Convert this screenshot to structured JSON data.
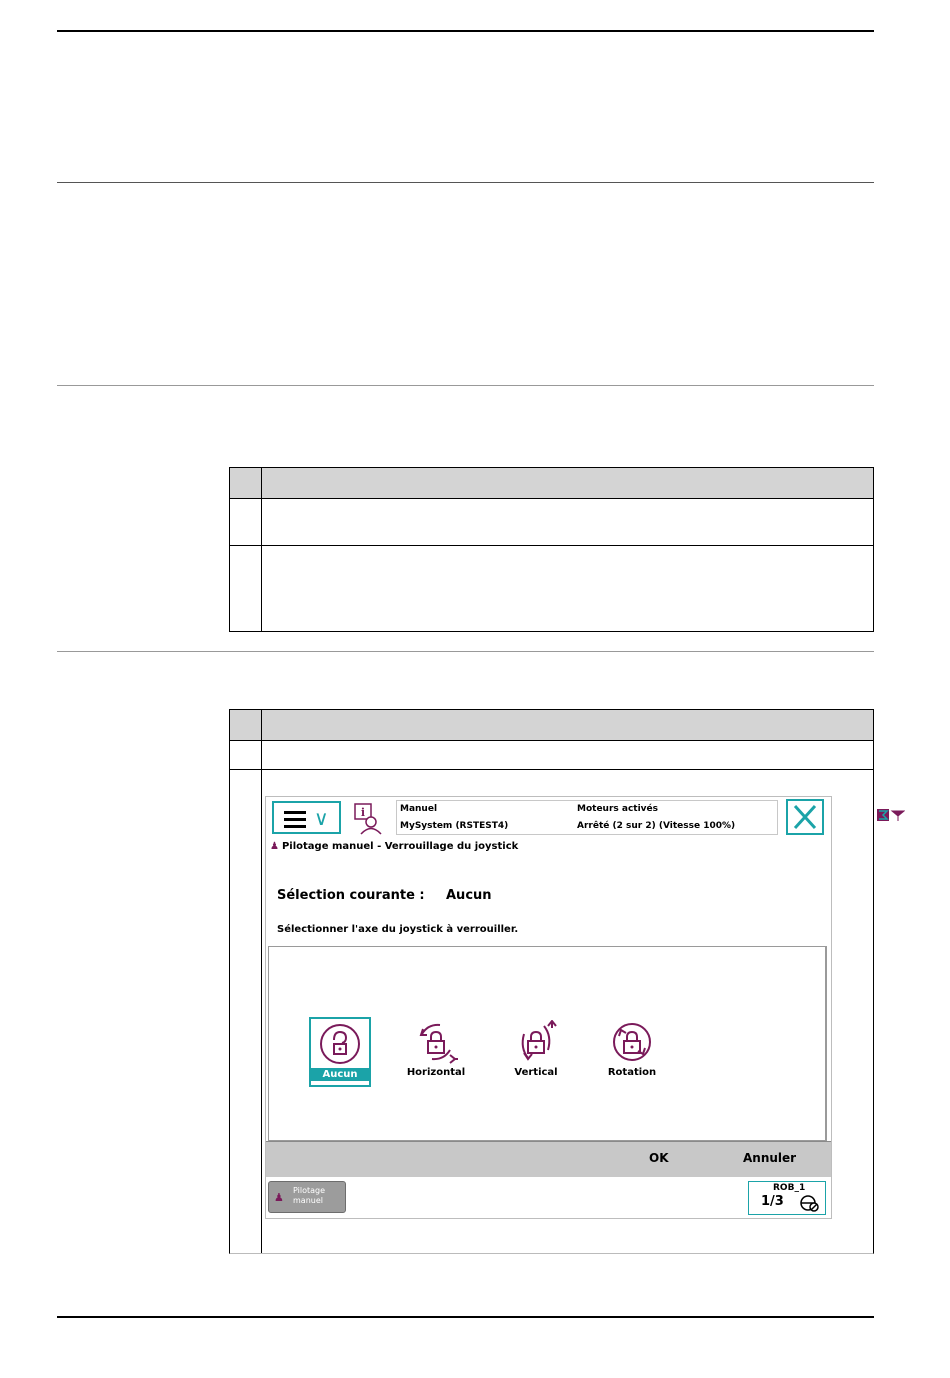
{
  "screen": {
    "status": {
      "mode": "Manuel",
      "system": "MySystem (RSTEST4)",
      "motors": "Moteurs activés",
      "state": "Arrêté (2 sur 2) (Vitesse 100%)"
    },
    "title": "Pilotage manuel - Verrouillage du joystick",
    "current_selection_label": "Sélection courante :",
    "current_selection_value": "Aucun",
    "instruction": "Sélectionner l'axe du joystick à verrouiller.",
    "options": [
      {
        "label": "Aucun",
        "icon": "unlocked-icon",
        "selected": true
      },
      {
        "label": "Horizontal",
        "icon": "lock-horizontal-icon",
        "selected": false
      },
      {
        "label": "Vertical",
        "icon": "lock-vertical-icon",
        "selected": false
      },
      {
        "label": "Rotation",
        "icon": "lock-rotation-icon",
        "selected": false
      }
    ],
    "buttons": {
      "ok": "OK",
      "cancel": "Annuler"
    },
    "taskbar": {
      "task_label": "Pilotage manuel",
      "robot": "ROB_1",
      "speed_fraction": "1/3"
    },
    "colors": {
      "accent": "#1ba3a8",
      "icon_purple": "#7a1a5a",
      "command_bar": "#c8c8c8"
    }
  }
}
